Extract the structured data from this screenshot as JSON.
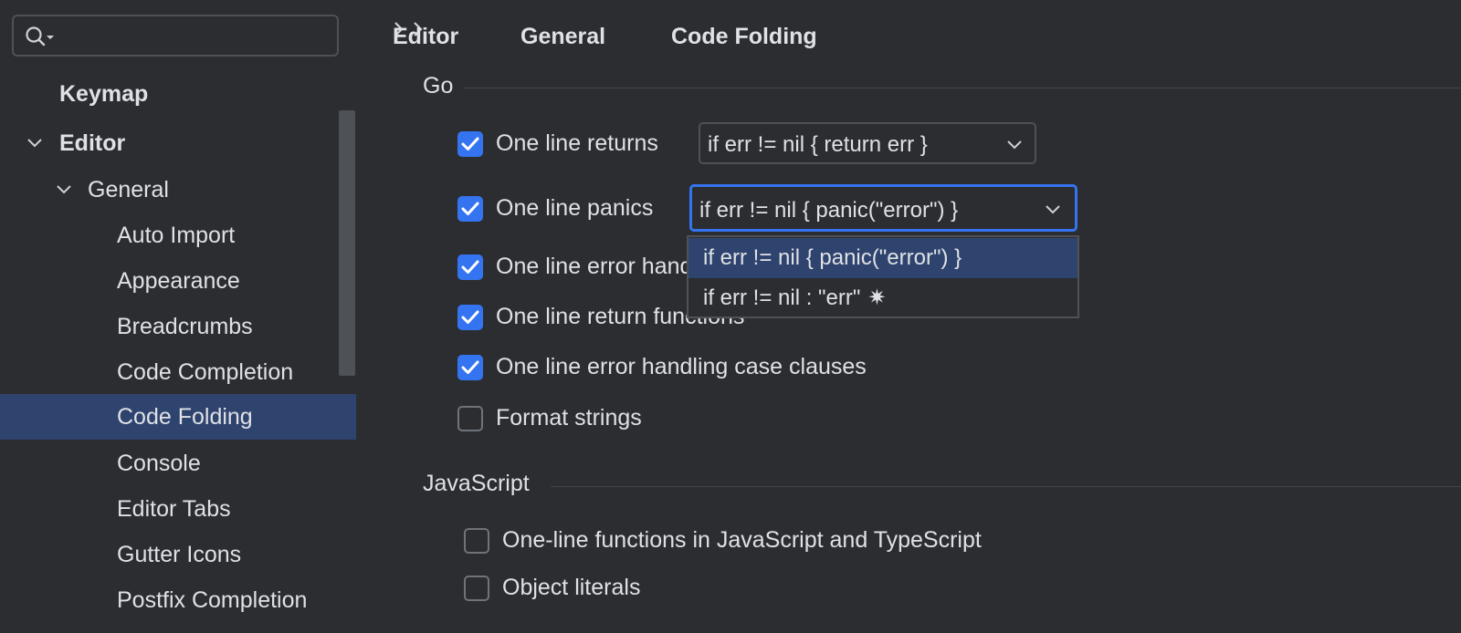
{
  "search": {
    "placeholder": "",
    "value": ""
  },
  "sidebar": {
    "items": [
      {
        "label": "Keymap"
      },
      {
        "label": "Editor"
      },
      {
        "label": "General"
      },
      {
        "label": "Auto Import"
      },
      {
        "label": "Appearance"
      },
      {
        "label": "Breadcrumbs"
      },
      {
        "label": "Code Completion"
      },
      {
        "label": "Code Folding"
      },
      {
        "label": "Console"
      },
      {
        "label": "Editor Tabs"
      },
      {
        "label": "Gutter Icons"
      },
      {
        "label": "Postfix Completion"
      }
    ],
    "selected": "Code Folding"
  },
  "breadcrumb": [
    "Editor",
    "General",
    "Code Folding"
  ],
  "sections": {
    "go": {
      "title": "Go",
      "options": [
        {
          "label": "One line returns",
          "checked": true
        },
        {
          "label": "One line panics",
          "checked": true
        },
        {
          "label": "One line error handling",
          "checked": true
        },
        {
          "label": "One line return functions",
          "checked": true
        },
        {
          "label": "One line error handling case clauses",
          "checked": true
        },
        {
          "label": "Format strings",
          "checked": false
        }
      ],
      "returns_combo": "if err != nil { return err }",
      "panics_combo": "if err != nil { panic(\"error\") }",
      "popup_options": [
        {
          "label": "if err != nil { panic(\"error\") }"
        },
        {
          "label": "if err != nil : \"err\"",
          "symbol": "✷"
        }
      ]
    },
    "javascript": {
      "title": "JavaScript",
      "options": [
        {
          "label": "One-line functions in JavaScript and TypeScript",
          "checked": false
        },
        {
          "label": "Object literals",
          "checked": false
        }
      ]
    }
  },
  "colors": {
    "background": "#2b2d30",
    "selection": "#2e436e",
    "accent": "#3574f0",
    "text": "#dfe1e5"
  }
}
